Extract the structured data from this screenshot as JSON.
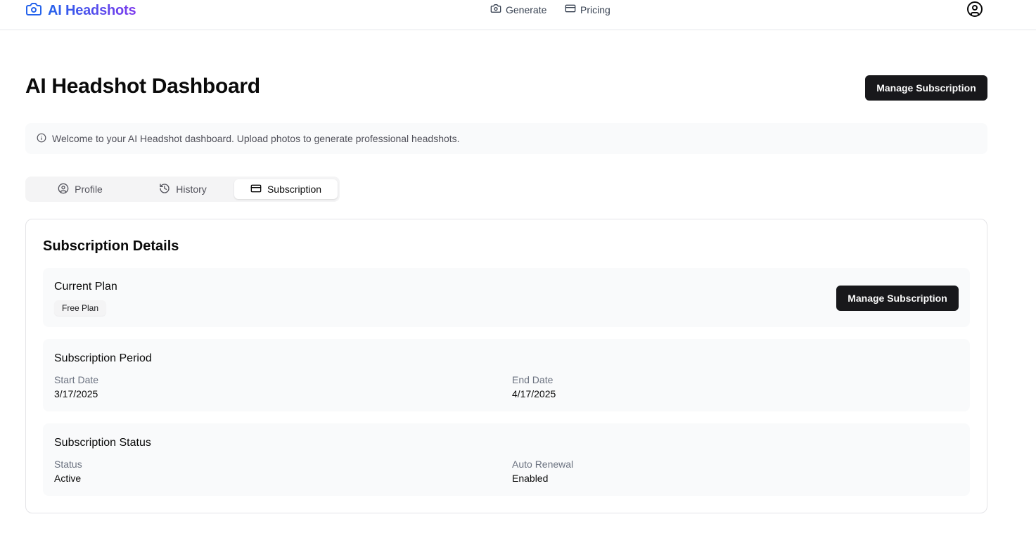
{
  "nav": {
    "brand": "AI Headshots",
    "links": [
      {
        "label": "Generate",
        "icon": "camera-icon"
      },
      {
        "label": "Pricing",
        "icon": "credit-card-icon"
      }
    ],
    "user_icon": "user-circle-icon"
  },
  "header": {
    "title": "AI Headshot Dashboard",
    "manage_button": "Manage Subscription"
  },
  "alert": {
    "icon": "info-icon",
    "text": "Welcome to your AI Headshot dashboard. Upload photos to generate professional headshots."
  },
  "tabs": [
    {
      "label": "Profile",
      "icon": "user-circle-icon",
      "active": false
    },
    {
      "label": "History",
      "icon": "history-icon",
      "active": false
    },
    {
      "label": "Subscription",
      "icon": "credit-card-icon",
      "active": true
    }
  ],
  "subscription": {
    "title": "Subscription Details",
    "current_plan": {
      "title": "Current Plan",
      "badge": "Free Plan",
      "button": "Manage Subscription"
    },
    "period": {
      "title": "Subscription Period",
      "start_label": "Start Date",
      "start_value": "3/17/2025",
      "end_label": "End Date",
      "end_value": "4/17/2025"
    },
    "status": {
      "title": "Subscription Status",
      "status_label": "Status",
      "status_value": "Active",
      "renewal_label": "Auto Renewal",
      "renewal_value": "Enabled"
    }
  },
  "colors": {
    "brand_gradient_start": "#2563eb",
    "brand_gradient_end": "#7c3aed",
    "button_dark": "#18181b"
  }
}
